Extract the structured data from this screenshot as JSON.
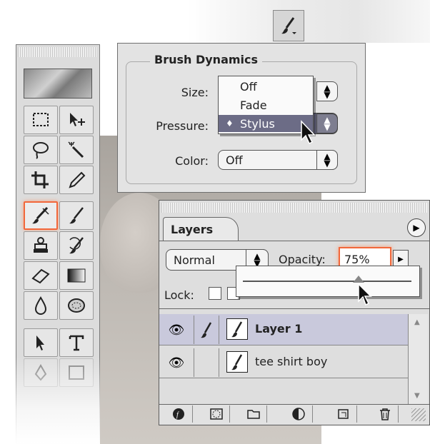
{
  "brush_dynamics": {
    "title": "Brush Dynamics",
    "size_label": "Size:",
    "pressure_label": "Pressure:",
    "color_label": "Color:",
    "color_value": "Off",
    "popup_options": [
      "Off",
      "Fade",
      "Stylus"
    ],
    "selected_option": "Stylus",
    "selected_marker": "♦"
  },
  "layers_panel": {
    "tab_label": "Layers",
    "blend_mode": "Normal",
    "opacity_label": "Opacity:",
    "opacity_value": "75%",
    "lock_label": "Lock:",
    "layers": [
      {
        "name": "Layer 1",
        "selected": true
      },
      {
        "name": "tee shirt boy",
        "selected": false
      }
    ]
  },
  "colors": {
    "highlight": "#f2673a",
    "selection": "#6c6c86",
    "panel_bg": "#dedede"
  },
  "icons": {
    "toolbox": [
      "marquee-icon",
      "move-icon",
      "lasso-icon",
      "magic-wand-icon",
      "crop-icon",
      "eyedropper-icon",
      "airbrush-icon",
      "paintbrush-icon",
      "stamp-icon",
      "history-brush-icon",
      "eraser-icon",
      "gradient-icon",
      "blur-icon",
      "dodge-icon",
      "path-select-icon",
      "type-icon",
      "pen-icon",
      "shape-icon"
    ],
    "layers_bottom": [
      "layer-style-icon",
      "mask-icon",
      "new-set-icon",
      "adjustment-layer-icon",
      "new-layer-icon",
      "trash-icon"
    ]
  }
}
